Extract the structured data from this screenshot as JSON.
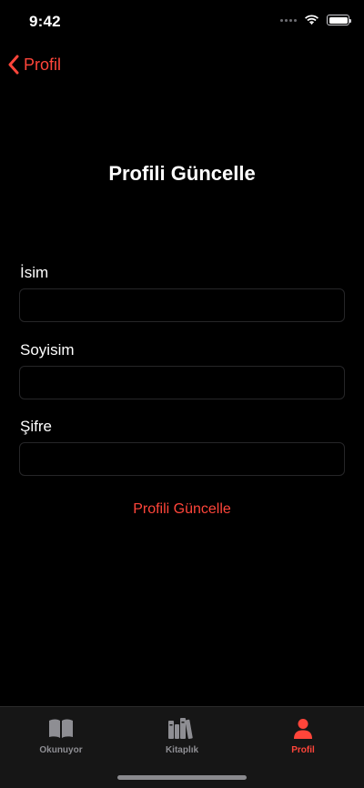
{
  "status_bar": {
    "time": "9:42",
    "icons": [
      "signal-dots-icon",
      "wifi-icon",
      "battery-icon"
    ]
  },
  "nav": {
    "back_label": "Profil",
    "back_icon": "chevron-left-icon"
  },
  "page": {
    "title": "Profili Güncelle"
  },
  "form": {
    "fields": [
      {
        "label": "İsim",
        "value": "",
        "placeholder": ""
      },
      {
        "label": "Soyisim",
        "value": "",
        "placeholder": ""
      },
      {
        "label": "Şifre",
        "value": "",
        "placeholder": ""
      }
    ],
    "submit_label": "Profili Güncelle"
  },
  "tab_bar": {
    "items": [
      {
        "label": "Okunuyor",
        "icon": "open-book-icon",
        "active": false
      },
      {
        "label": "Kitaplık",
        "icon": "books-icon",
        "active": false
      },
      {
        "label": "Profil",
        "icon": "person-icon",
        "active": true
      }
    ]
  },
  "colors": {
    "accent": "#ff453a",
    "background": "#000000",
    "tab_bar_bg": "#161616",
    "inactive_tab": "#8e8e93",
    "input_border": "#262628"
  }
}
